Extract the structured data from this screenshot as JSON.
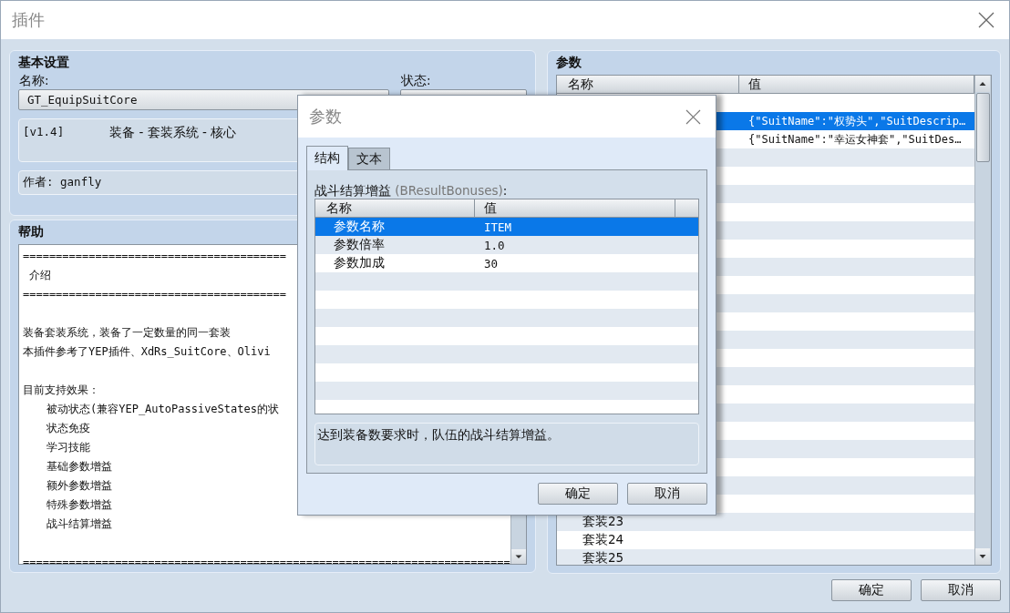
{
  "window": {
    "title": "插件"
  },
  "basic_settings": {
    "title": "基本设置",
    "name_label": "名称:",
    "name_value": "GT_EquipSuitCore",
    "status_label": "状态:",
    "version": "[v1.4]",
    "description": "装备 - 套装系统 - 核心",
    "author": "作者: ganfly"
  },
  "help": {
    "title": "帮助",
    "lines": [
      {
        "kind": "text",
        "text": "========================================"
      },
      {
        "kind": "text",
        "text": " 介绍"
      },
      {
        "kind": "text",
        "text": "========================================"
      },
      {
        "kind": "blank"
      },
      {
        "kind": "text",
        "text": "装备套装系统，装备了一定数量的同一套装"
      },
      {
        "kind": "text",
        "text": "本插件参考了YEP插件、XdRs_SuitCore、Olivi"
      },
      {
        "kind": "blank"
      },
      {
        "kind": "text",
        "text": "目前支持效果：",
        "children": [
          {
            "kind": "text",
            "text": "被动状态(兼容YEP_AutoPassiveStates的状"
          },
          {
            "kind": "text",
            "text": "状态免疫"
          },
          {
            "kind": "text",
            "text": "学习技能"
          },
          {
            "kind": "text",
            "text": "基础参数增益"
          },
          {
            "kind": "text",
            "text": "额外参数增益"
          },
          {
            "kind": "text",
            "text": "特殊参数增益"
          },
          {
            "kind": "text",
            "text": "战斗结算增益"
          }
        ]
      },
      {
        "kind": "blank"
      },
      {
        "kind": "text",
        "text": "=========================================================================="
      }
    ]
  },
  "parameters": {
    "title": "参数",
    "columns": [
      "名称",
      "值"
    ],
    "rows": [
      {
        "selected": false
      },
      {
        "selected": true,
        "value": "{\"SuitName\":\"权势头\",\"SuitDescrip…"
      },
      {
        "selected": false,
        "value": "{\"SuitName\":\"幸运女神套\",\"SuitDes…"
      },
      {
        "selected": false
      },
      {
        "selected": false
      },
      {
        "selected": false
      },
      {
        "selected": false
      },
      {
        "selected": false
      },
      {
        "selected": false
      },
      {
        "selected": false
      },
      {
        "selected": false
      },
      {
        "selected": false
      },
      {
        "selected": false
      },
      {
        "selected": false
      },
      {
        "selected": false
      },
      {
        "selected": false
      },
      {
        "selected": false
      },
      {
        "selected": false
      },
      {
        "selected": false
      },
      {
        "selected": false
      },
      {
        "selected": false
      },
      {
        "selected": false
      },
      {
        "selected": false
      },
      {
        "selected": false,
        "name": "套装23"
      },
      {
        "selected": false,
        "name": "套装24"
      },
      {
        "selected": false,
        "name": "套装25"
      }
    ]
  },
  "buttons": [
    "确定",
    "取消"
  ],
  "dialog": {
    "title": "参数",
    "tabs": [
      {
        "label": "结构",
        "selected": true
      },
      {
        "label": "文本",
        "selected": false
      }
    ],
    "field_label": "战斗结算增益",
    "field_key": "(BResultBonuses)",
    "field_suffix": ":",
    "columns": [
      "名称",
      "值"
    ],
    "rows": [
      {
        "selected": true,
        "name": "参数名称",
        "value": "ITEM"
      },
      {
        "selected": false,
        "name": "参数倍率",
        "value": "1.0"
      },
      {
        "selected": false,
        "name": "参数加成",
        "value": "30"
      },
      {
        "selected": false
      },
      {
        "selected": false
      },
      {
        "selected": false
      },
      {
        "selected": false
      },
      {
        "selected": false
      },
      {
        "selected": false
      },
      {
        "selected": false
      },
      {
        "selected": false
      }
    ],
    "description": "达到装备数要求时，队伍的战斗结算增益。",
    "buttons": [
      "确定",
      "取消"
    ]
  }
}
